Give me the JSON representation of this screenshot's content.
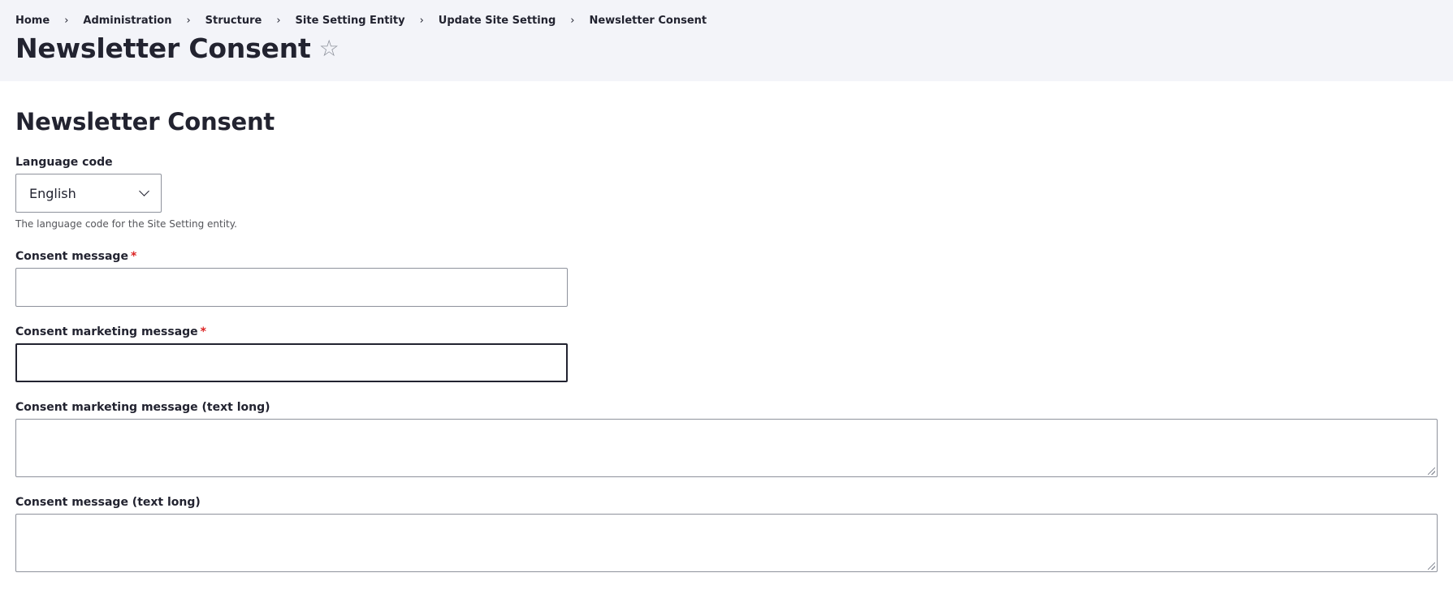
{
  "breadcrumb": {
    "items": [
      "Home",
      "Administration",
      "Structure",
      "Site Setting Entity",
      "Update Site Setting",
      "Newsletter Consent"
    ],
    "separator": "›"
  },
  "header": {
    "title": "Newsletter Consent",
    "star_glyph": "☆"
  },
  "form": {
    "title": "Newsletter Consent",
    "language": {
      "label": "Language code",
      "value": "English",
      "description": "The language code for the Site Setting entity."
    },
    "consent_message": {
      "label": "Consent message",
      "required_marker": "*",
      "value": ""
    },
    "consent_marketing_message": {
      "label": "Consent marketing message",
      "required_marker": "*",
      "value": ""
    },
    "consent_marketing_message_long": {
      "label": "Consent marketing message (text long)",
      "value": ""
    },
    "consent_message_long": {
      "label": "Consent message (text long)",
      "value": ""
    }
  },
  "colors": {
    "header_bg": "#f3f4f9",
    "required": "#dc2323",
    "border": "#8e929c",
    "text": "#222330"
  },
  "icons": {
    "star": "star-outline-icon",
    "chevron": "chevron-down-icon",
    "separator": "chevron-right-icon"
  }
}
